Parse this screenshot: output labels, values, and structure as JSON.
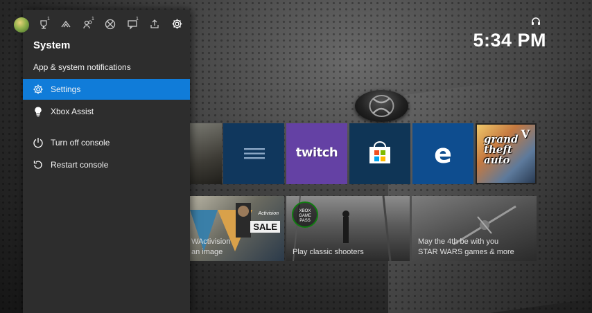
{
  "clock": {
    "time": "5:34 PM"
  },
  "guide": {
    "tabs": [
      {
        "icon": "profile-avatar",
        "badge": ""
      },
      {
        "icon": "trophy-icon",
        "badge": "1"
      },
      {
        "icon": "multiplayer-icon",
        "badge": ""
      },
      {
        "icon": "friends-icon",
        "badge": "1"
      },
      {
        "icon": "xbox-icon",
        "badge": ""
      },
      {
        "icon": "chat-icon",
        "badge": "1"
      },
      {
        "icon": "share-icon",
        "badge": ""
      },
      {
        "icon": "gear-icon",
        "badge": ""
      }
    ],
    "section_title": "System",
    "notifications_label": "App & system notifications",
    "items": [
      {
        "label": "Settings",
        "icon": "gear-icon",
        "selected": true
      },
      {
        "label": "Xbox Assist",
        "icon": "lightbulb-icon",
        "selected": false
      },
      {
        "label": "Turn off console",
        "icon": "power-icon",
        "selected": false
      },
      {
        "label": "Restart console",
        "icon": "restart-icon",
        "selected": false
      }
    ]
  },
  "tiles": {
    "twitch_logo": "twitch",
    "edge_logo": "e",
    "gta_logo": "grand theft auto",
    "gta_numeral": "V",
    "sale_badge": "SALE",
    "activision_mark": "Activision",
    "sale_caption_1": "WActivision",
    "sale_caption_2": "an image",
    "gamepass_badge_1": "XBOX",
    "gamepass_badge_2": "GAME",
    "gamepass_badge_3": "PASS",
    "gamepass_caption": "Play classic shooters",
    "starwars_caption_1": "May the 4th be with you",
    "starwars_caption_2": "STAR WARS games & more"
  },
  "colors": {
    "accent": "#107cd9",
    "guide_bg": "#2d2d2d",
    "twitch": "#6441a4",
    "edge": "#0e4d8f",
    "xbox_green": "#107c10"
  }
}
